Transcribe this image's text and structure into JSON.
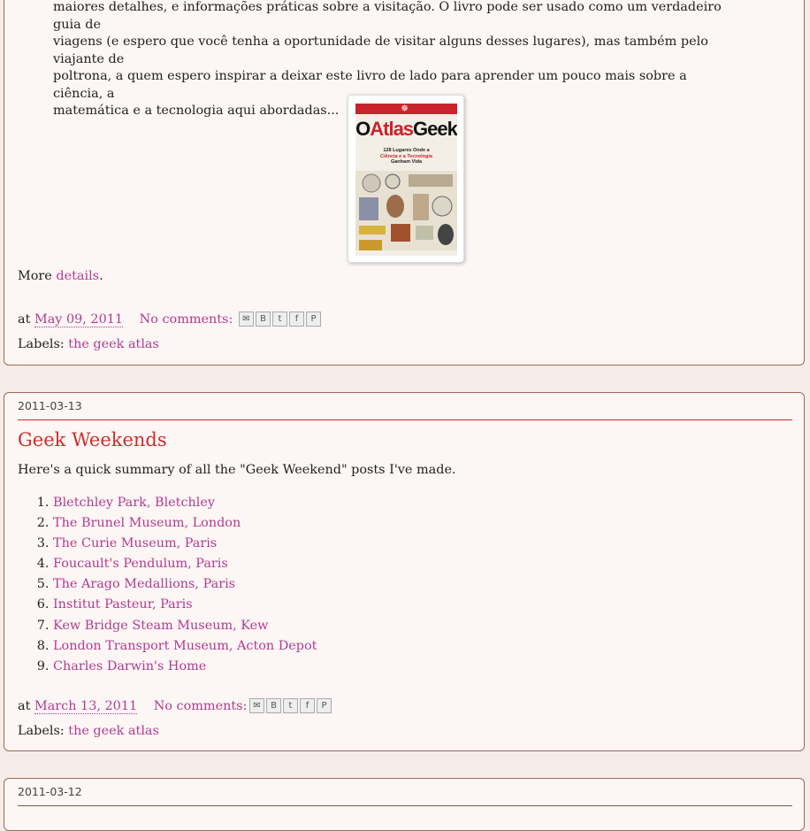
{
  "post1": {
    "intro_lines": [
      "maiores detalhes, e informações práticas sobre a visitação. O livro pode ser usado como um verdadeiro guia de",
      "viagens (e espero que você tenha a oportunidade de visitar alguns desses lugares), mas também pelo viajante de",
      "poltrona, a quem espero inspirar a deixar este livro de lado para aprender um pouco mais sobre a ciência, a",
      "matemática e a tecnologia aqui abordadas..."
    ],
    "book_cover": {
      "title_part1": "O",
      "title_part2": "Atlas",
      "title_part3": "Geek",
      "subtitle_line1": "128 Lugares Onde a",
      "subtitle_line2": "Ciência e a Tecnologia",
      "subtitle_line3": "Ganham Vida"
    },
    "more_prefix": "More",
    "more_link": "details",
    "more_suffix": ".",
    "at_label": "at",
    "date_link": "May 09, 2011",
    "comments_link": "No comments:",
    "labels_label": "Labels:",
    "label_link": "the geek atlas"
  },
  "post2": {
    "date_header": "2011-03-13",
    "title": "Geek Weekends",
    "summary": "Here's a quick summary of all the \"Geek Weekend\" posts I've made.",
    "items": [
      "Bletchley Park, Bletchley",
      "The Brunel Museum, London",
      "The Curie Museum, Paris",
      "Foucault's Pendulum, Paris",
      "The Arago Medallions, Paris",
      "Institut Pasteur, Paris",
      "Kew Bridge Steam Museum, Kew",
      "London Transport Museum, Acton Depot",
      "Charles Darwin's Home"
    ],
    "at_label": "at",
    "date_link": "March 13, 2011",
    "comments_link": "No comments:",
    "labels_label": "Labels:",
    "label_link": "the geek atlas"
  },
  "post3": {
    "date_header": "2011-03-12"
  },
  "share_icons": [
    "email-icon",
    "blogthis-icon",
    "twitter-icon",
    "facebook-icon",
    "pinterest-icon"
  ],
  "colors": {
    "link": "#b03c8f",
    "title": "#c9302c",
    "page_bg": "#f6ece8",
    "post_bg": "#fcf6f5",
    "border": "#9d6a55"
  }
}
